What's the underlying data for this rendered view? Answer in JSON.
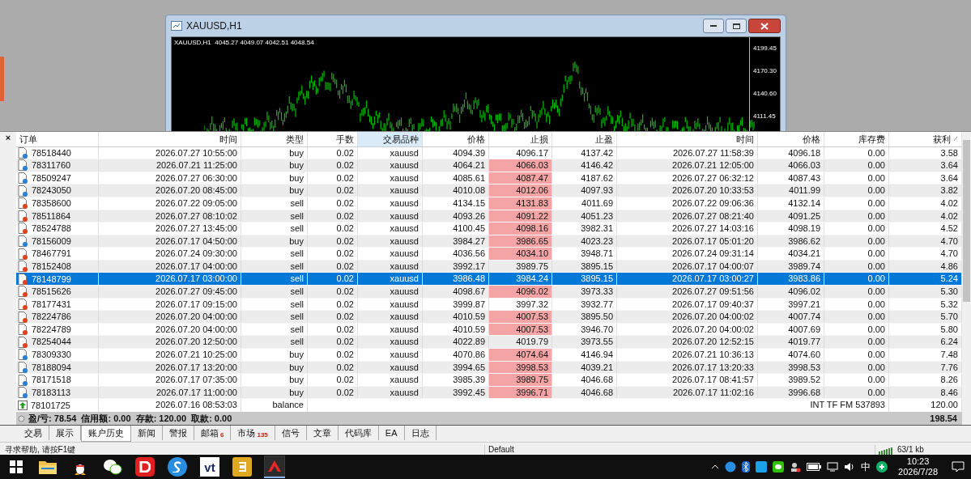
{
  "chart_window": {
    "title": "XAUUSD,H1",
    "chart_header": "XAUUSD,H1  4045.27 4049.07 4042.51 4048.54",
    "price_scale": [
      "4199.45",
      "4170.30",
      "4140.60",
      "4111.45"
    ]
  },
  "panel": {
    "close": "×"
  },
  "table": {
    "columns": [
      {
        "label": "订单",
        "highlighted": false,
        "sorted": false
      },
      {
        "label": "时间",
        "highlighted": false,
        "sorted": false
      },
      {
        "label": "类型",
        "highlighted": false,
        "sorted": false
      },
      {
        "label": "手数",
        "highlighted": false,
        "sorted": false
      },
      {
        "label": "交易品种",
        "highlighted": true,
        "sorted": false
      },
      {
        "label": "价格",
        "highlighted": false,
        "sorted": false
      },
      {
        "label": "止损",
        "highlighted": false,
        "sorted": false
      },
      {
        "label": "止盈",
        "highlighted": false,
        "sorted": false
      },
      {
        "label": "时间",
        "highlighted": false,
        "sorted": false
      },
      {
        "label": "价格",
        "highlighted": false,
        "sorted": false
      },
      {
        "label": "库存费",
        "highlighted": false,
        "sorted": false
      },
      {
        "label": "获利",
        "highlighted": false,
        "sorted": true
      }
    ],
    "rows": [
      {
        "kind": "buy",
        "selected": false,
        "sl_hit": false,
        "cells": [
          "78518440",
          "2026.07.27 10:55:00",
          "buy",
          "0.02",
          "xauusd",
          "4094.39",
          "4096.17",
          "4137.42",
          "2026.07.27 11:58:39",
          "4096.18",
          "0.00",
          "3.58"
        ]
      },
      {
        "kind": "buy",
        "selected": false,
        "sl_hit": true,
        "cells": [
          "78311760",
          "2026.07.21 11:25:00",
          "buy",
          "0.02",
          "xauusd",
          "4064.21",
          "4066.03",
          "4146.42",
          "2026.07.21 12:05:00",
          "4066.03",
          "0.00",
          "3.64"
        ]
      },
      {
        "kind": "buy",
        "selected": false,
        "sl_hit": true,
        "cells": [
          "78509247",
          "2026.07.27 06:30:00",
          "buy",
          "0.02",
          "xauusd",
          "4085.61",
          "4087.47",
          "4187.62",
          "2026.07.27 06:32:12",
          "4087.43",
          "0.00",
          "3.64"
        ]
      },
      {
        "kind": "buy",
        "selected": false,
        "sl_hit": true,
        "cells": [
          "78243050",
          "2026.07.20 08:45:00",
          "buy",
          "0.02",
          "xauusd",
          "4010.08",
          "4012.06",
          "4097.93",
          "2026.07.20 10:33:53",
          "4011.99",
          "0.00",
          "3.82"
        ]
      },
      {
        "kind": "sell",
        "selected": false,
        "sl_hit": true,
        "cells": [
          "78358600",
          "2026.07.22 09:05:00",
          "sell",
          "0.02",
          "xauusd",
          "4134.15",
          "4131.83",
          "4011.69",
          "2026.07.22 09:06:36",
          "4132.14",
          "0.00",
          "4.02"
        ]
      },
      {
        "kind": "sell",
        "selected": false,
        "sl_hit": true,
        "cells": [
          "78511864",
          "2026.07.27 08:10:02",
          "sell",
          "0.02",
          "xauusd",
          "4093.26",
          "4091.22",
          "4051.23",
          "2026.07.27 08:21:40",
          "4091.25",
          "0.00",
          "4.02"
        ]
      },
      {
        "kind": "sell",
        "selected": false,
        "sl_hit": true,
        "cells": [
          "78524788",
          "2026.07.27 13:45:00",
          "sell",
          "0.02",
          "xauusd",
          "4100.45",
          "4098.16",
          "3982.31",
          "2026.07.27 14:03:16",
          "4098.19",
          "0.00",
          "4.52"
        ]
      },
      {
        "kind": "buy",
        "selected": false,
        "sl_hit": true,
        "cells": [
          "78156009",
          "2026.07.17 04:50:00",
          "buy",
          "0.02",
          "xauusd",
          "3984.27",
          "3986.65",
          "4023.23",
          "2026.07.17 05:01:20",
          "3986.62",
          "0.00",
          "4.70"
        ]
      },
      {
        "kind": "sell",
        "selected": false,
        "sl_hit": true,
        "cells": [
          "78467791",
          "2026.07.24 09:30:00",
          "sell",
          "0.02",
          "xauusd",
          "4036.56",
          "4034.10",
          "3948.71",
          "2026.07.24 09:31:14",
          "4034.21",
          "0.00",
          "4.70"
        ]
      },
      {
        "kind": "sell",
        "selected": false,
        "sl_hit": false,
        "cells": [
          "78152408",
          "2026.07.17 04:00:00",
          "sell",
          "0.02",
          "xauusd",
          "3992.17",
          "3989.75",
          "3895.15",
          "2026.07.17 04:00:07",
          "3989.74",
          "0.00",
          "4.86"
        ]
      },
      {
        "kind": "sell",
        "selected": true,
        "sl_hit": false,
        "cells": [
          "78148799",
          "2026.07.17 03:00:00",
          "sell",
          "0.02",
          "xauusd",
          "3986.48",
          "3984.24",
          "3895.15",
          "2026.07.17 03:00:27",
          "3983.86",
          "0.00",
          "5.24"
        ]
      },
      {
        "kind": "sell",
        "selected": false,
        "sl_hit": true,
        "cells": [
          "78515626",
          "2026.07.27 09:45:00",
          "sell",
          "0.02",
          "xauusd",
          "4098.67",
          "4096.02",
          "3973.33",
          "2026.07.27 09:51:56",
          "4096.02",
          "0.00",
          "5.30"
        ]
      },
      {
        "kind": "sell",
        "selected": false,
        "sl_hit": false,
        "cells": [
          "78177431",
          "2026.07.17 09:15:00",
          "sell",
          "0.02",
          "xauusd",
          "3999.87",
          "3997.32",
          "3932.77",
          "2026.07.17 09:40:37",
          "3997.21",
          "0.00",
          "5.32"
        ]
      },
      {
        "kind": "sell",
        "selected": false,
        "sl_hit": true,
        "cells": [
          "78224786",
          "2026.07.20 04:00:00",
          "sell",
          "0.02",
          "xauusd",
          "4010.59",
          "4007.53",
          "3895.50",
          "2026.07.20 04:00:02",
          "4007.74",
          "0.00",
          "5.70"
        ]
      },
      {
        "kind": "sell",
        "selected": false,
        "sl_hit": true,
        "cells": [
          "78224789",
          "2026.07.20 04:00:00",
          "sell",
          "0.02",
          "xauusd",
          "4010.59",
          "4007.53",
          "3946.70",
          "2026.07.20 04:00:02",
          "4007.69",
          "0.00",
          "5.80"
        ]
      },
      {
        "kind": "sell",
        "selected": false,
        "sl_hit": false,
        "cells": [
          "78254044",
          "2026.07.20 12:50:00",
          "sell",
          "0.02",
          "xauusd",
          "4022.89",
          "4019.79",
          "3973.55",
          "2026.07.20 12:52:15",
          "4019.77",
          "0.00",
          "6.24"
        ]
      },
      {
        "kind": "buy",
        "selected": false,
        "sl_hit": true,
        "cells": [
          "78309330",
          "2026.07.21 10:25:00",
          "buy",
          "0.02",
          "xauusd",
          "4070.86",
          "4074.64",
          "4146.94",
          "2026.07.21 10:36:13",
          "4074.60",
          "0.00",
          "7.48"
        ]
      },
      {
        "kind": "buy",
        "selected": false,
        "sl_hit": true,
        "cells": [
          "78188094",
          "2026.07.17 13:20:00",
          "buy",
          "0.02",
          "xauusd",
          "3994.65",
          "3998.53",
          "4039.21",
          "2026.07.17 13:20:33",
          "3998.53",
          "0.00",
          "7.76"
        ]
      },
      {
        "kind": "buy",
        "selected": false,
        "sl_hit": true,
        "cells": [
          "78171518",
          "2026.07.17 07:35:00",
          "buy",
          "0.02",
          "xauusd",
          "3985.39",
          "3989.75",
          "4046.68",
          "2026.07.17 08:41:57",
          "3989.52",
          "0.00",
          "8.26"
        ]
      },
      {
        "kind": "buy",
        "selected": false,
        "sl_hit": true,
        "cells": [
          "78183113",
          "2026.07.17 11:00:00",
          "buy",
          "0.02",
          "xauusd",
          "3992.45",
          "3996.71",
          "4046.68",
          "2026.07.17 11:02:16",
          "3996.68",
          "0.00",
          "8.46"
        ]
      },
      {
        "kind": "balance",
        "selected": false,
        "cells": [
          "78101725",
          "2026.07.16 08:53:03",
          "balance",
          "",
          "",
          "",
          "",
          "",
          "",
          "",
          "INT TF FM 537893",
          "120.00"
        ]
      }
    ],
    "summary": {
      "text": "盈/亏: 78.54  信用额: 0.00  存款: 120.00  取款: 0.00",
      "total": "198.54"
    }
  },
  "tabs": [
    {
      "label": "交易",
      "selected": false
    },
    {
      "label": "展示",
      "selected": false
    },
    {
      "label": "账户历史",
      "selected": true
    },
    {
      "label": "新闻",
      "selected": false
    },
    {
      "label": "警报",
      "selected": false
    },
    {
      "label": "邮箱",
      "selected": false,
      "badge": "6"
    },
    {
      "label": "市场",
      "selected": false,
      "badge": "135"
    },
    {
      "label": "信号",
      "selected": false
    },
    {
      "label": "文章",
      "selected": false
    },
    {
      "label": "代码库",
      "selected": false
    },
    {
      "label": "EA",
      "selected": false
    },
    {
      "label": "日志",
      "selected": false
    }
  ],
  "status_bar": {
    "help": "寻求帮助, 请按F1键",
    "profile": "Default",
    "traffic": "63/1 kb"
  },
  "taskbar": {
    "apps": [
      {
        "kind": "folder"
      },
      {
        "kind": "penguin"
      },
      {
        "kind": "chat"
      },
      {
        "kind": "red-d"
      },
      {
        "kind": "blue-s"
      },
      {
        "kind": "vt",
        "label": "vt"
      },
      {
        "kind": "yellow"
      },
      {
        "kind": "terminal"
      }
    ],
    "ime": "中",
    "time": "10:23",
    "date": "2026/7/28"
  }
}
